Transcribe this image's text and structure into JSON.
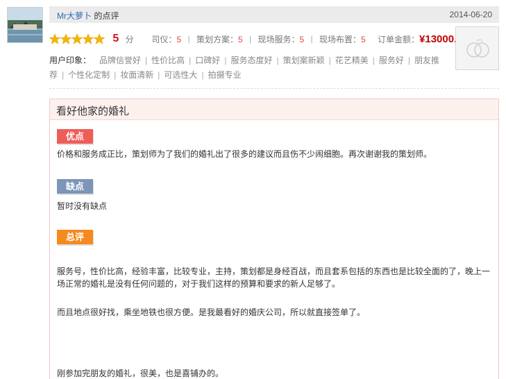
{
  "reviewer": {
    "name": "Mr大萝卜",
    "suffix": " 的点评"
  },
  "review_date": "2014-06-20",
  "rating": {
    "stars": 5,
    "score": "5",
    "score_unit": "分",
    "sub_ratings": [
      {
        "label": "司仪：",
        "value": "5"
      },
      {
        "label": "策划方案：",
        "value": "5"
      },
      {
        "label": "现场服务：",
        "value": "5"
      },
      {
        "label": "现场布置：",
        "value": "5"
      }
    ],
    "order_label": "订单金额：",
    "order_amount": "¥13000.00"
  },
  "impression": {
    "label": "用户印象：",
    "tags": [
      "品牌信誉好",
      "性价比高",
      "口碑好",
      "服务态度好",
      "策划案新颖",
      "花艺精美",
      "服务好",
      "朋友推荐",
      "个性化定制",
      "妆面清新",
      "可选性大",
      "拍摄专业"
    ]
  },
  "review": {
    "title": "看好他家的婚礼",
    "pros_label": "优点",
    "pros_text": "价格和服务成正比，策划师为了我们的婚礼出了很多的建议而且伤不少闹细胞。再次谢谢我的策划师。",
    "cons_label": "缺点",
    "cons_text": "暂时没有缺点",
    "summary_label": "总评",
    "summary_p1": "服务号，性价比高，经验丰富，比较专业，主持，策划都是身经百战，而且套系包括的东西也是比较全面的了，晚上一场正常的婚礼是没有任何问题的，对于我们这样的预算和要求的新人足够了。",
    "summary_p2": "而且地点很好找，乘坐地铁也很方便。是我最看好的婚庆公司，所以就直接签单了。",
    "summary_p3": "刚参加完朋友的婚礼，很美，也是喜铺办的。"
  },
  "colors": {
    "star": "#f7b500",
    "score": "#d4121d",
    "amount": "#c00000",
    "pros_badge": "#ef5d58",
    "cons_badge": "#7c95b8",
    "summary_badge": "#f58a1f",
    "link": "#2f68b4"
  },
  "icons": {
    "star": "star-icon",
    "thumbnail": "wedding-logo-icon"
  }
}
